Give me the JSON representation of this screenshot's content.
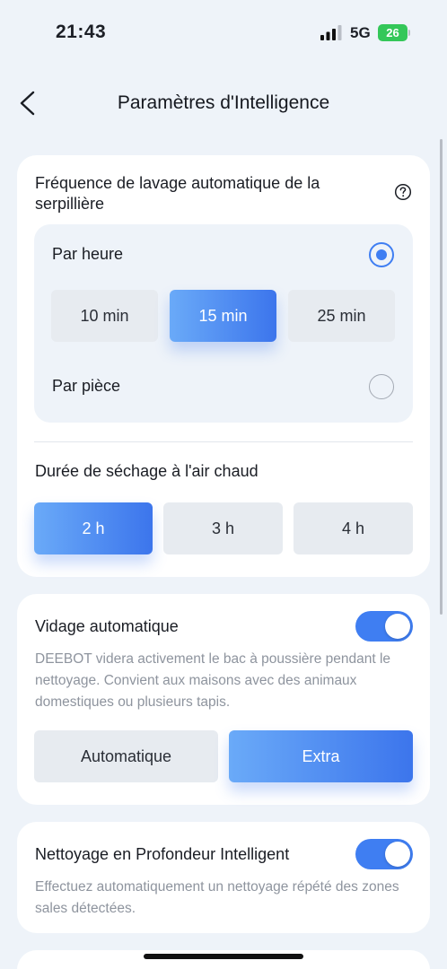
{
  "status_bar": {
    "time": "21:43",
    "network": "5G",
    "battery": "26"
  },
  "header": {
    "title": "Paramètres d'Intelligence",
    "back_icon": "chevron-left-icon"
  },
  "mop_wash": {
    "title": "Fréquence de lavage automatique de la serpillière",
    "help_icon": "question-circle-icon",
    "per_hour_label": "Par heure",
    "per_hour_selected": true,
    "intervals": [
      {
        "label": "10  min",
        "selected": false
      },
      {
        "label": "15  min",
        "selected": true
      },
      {
        "label": "25  min",
        "selected": false
      }
    ],
    "per_room_label": "Par pièce",
    "per_room_selected": false
  },
  "drying": {
    "title": "Durée de séchage à l'air chaud",
    "options": [
      {
        "label": "2 h",
        "selected": true
      },
      {
        "label": "3 h",
        "selected": false
      },
      {
        "label": "4 h",
        "selected": false
      }
    ]
  },
  "auto_empty": {
    "title": "Vidage automatique",
    "enabled": true,
    "description": "DEEBOT videra activement le bac à poussière pendant le nettoyage. Convient aux maisons avec des animaux domestiques ou plusieurs tapis.",
    "modes": [
      {
        "label": "Automatique",
        "selected": false
      },
      {
        "label": "Extra",
        "selected": true
      }
    ]
  },
  "deep_clean": {
    "title": "Nettoyage en Profondeur Intelligent",
    "enabled": true,
    "description": "Effectuez automatiquement un nettoyage répété des zones sales détectées."
  },
  "colors": {
    "accent": "#3f7ef2",
    "background": "#eef3f9",
    "card": "#ffffff",
    "chip": "#e7ebf0",
    "battery": "#34c759"
  }
}
